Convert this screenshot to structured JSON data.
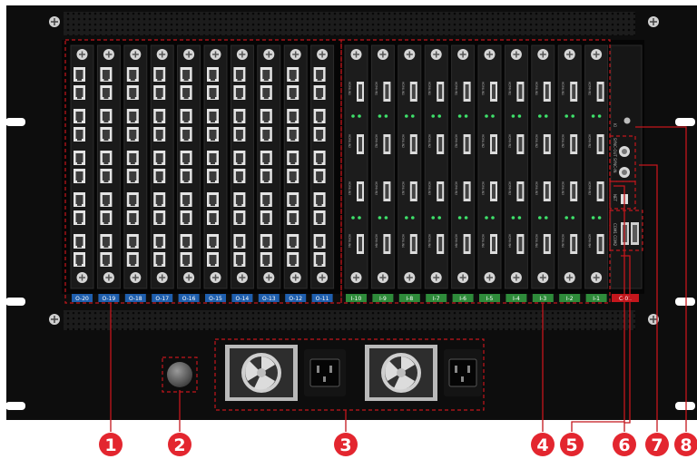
{
  "slot_labels": {
    "input": [
      "O-20",
      "O-19",
      "O-18",
      "O-17",
      "O-16",
      "O-15",
      "O-14",
      "O-13",
      "O-12",
      "O-11"
    ],
    "output": [
      "I-10",
      "I-9",
      "I-8",
      "I-7",
      "I-6",
      "I-5",
      "I-4",
      "I-3",
      "I-2",
      "I-1"
    ],
    "control": "C-01"
  },
  "card_port_labels": {
    "hdmi": [
      "HDMI-IN1",
      "HDMI-IN2",
      "HDMI-IN3",
      "HDMI-IN4"
    ]
  },
  "control_panel_labels": {
    "sync": "SYNC-OUT  SYNC-IN",
    "net": "NET",
    "com": "COM1  COM2",
    "io": "IO"
  },
  "callouts": [
    "1",
    "2",
    "3",
    "4",
    "5",
    "6",
    "7",
    "8"
  ],
  "colors": {
    "chassis": "#0d0d0d",
    "card": "#1a1a1a",
    "callout": "#e3262f",
    "slot_blue": "#1f5fae",
    "slot_green": "#2e8b3a",
    "slot_red": "#c4161c"
  }
}
